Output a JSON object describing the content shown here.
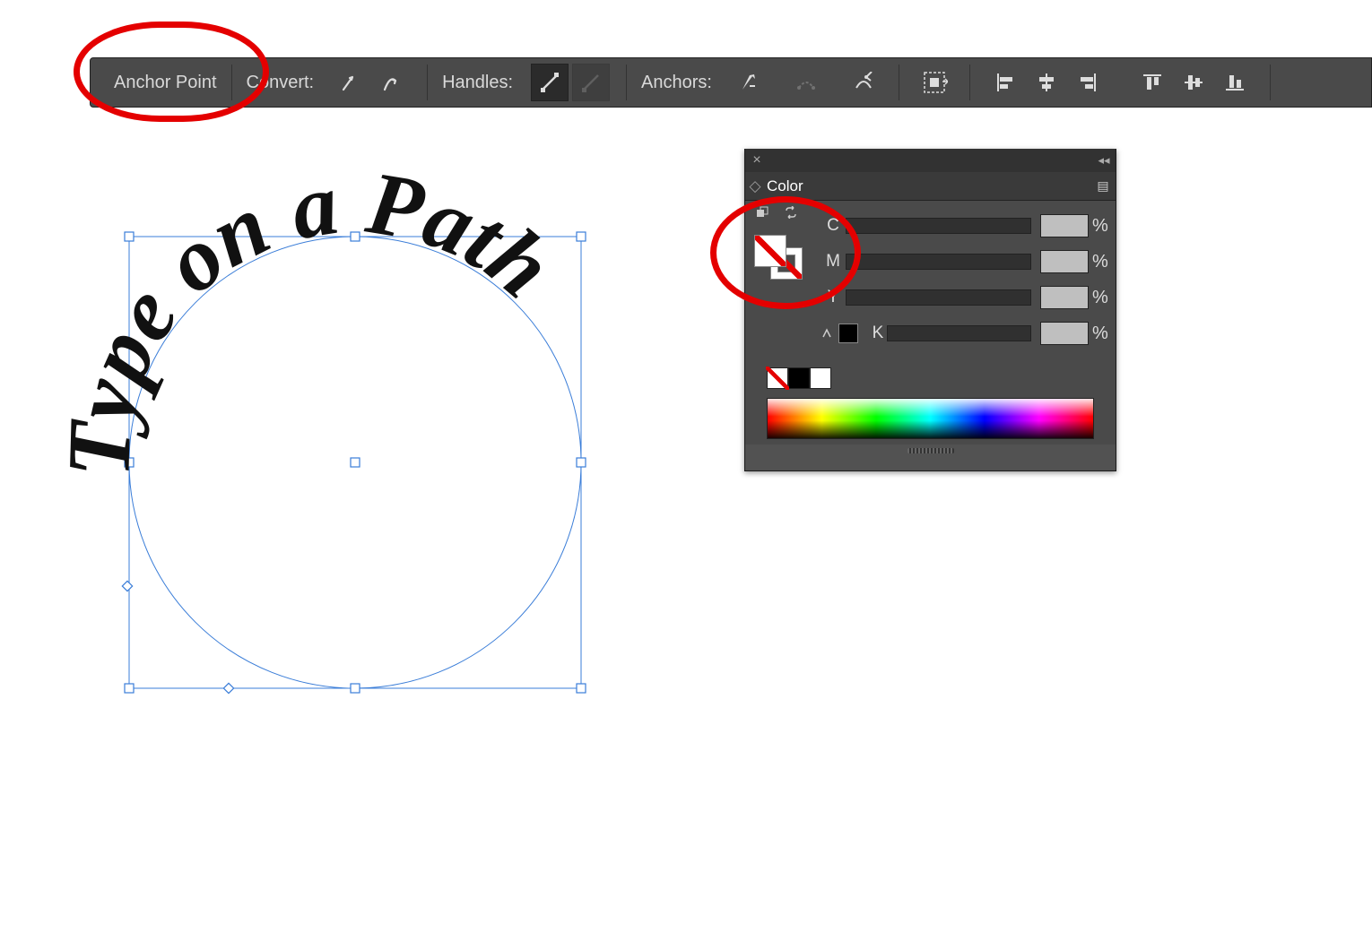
{
  "optionsBar": {
    "label_anchor": "Anchor Point",
    "label_convert": "Convert:",
    "label_handles": "Handles:",
    "label_anchors": "Anchors:"
  },
  "canvas": {
    "path_text": "Type on a Path"
  },
  "colorPanel": {
    "title": "Color",
    "channels": {
      "c": "C",
      "m": "M",
      "y": "Y",
      "k": "K"
    },
    "percent": "%",
    "values": {
      "c": "",
      "m": "",
      "y": "",
      "k": ""
    }
  }
}
